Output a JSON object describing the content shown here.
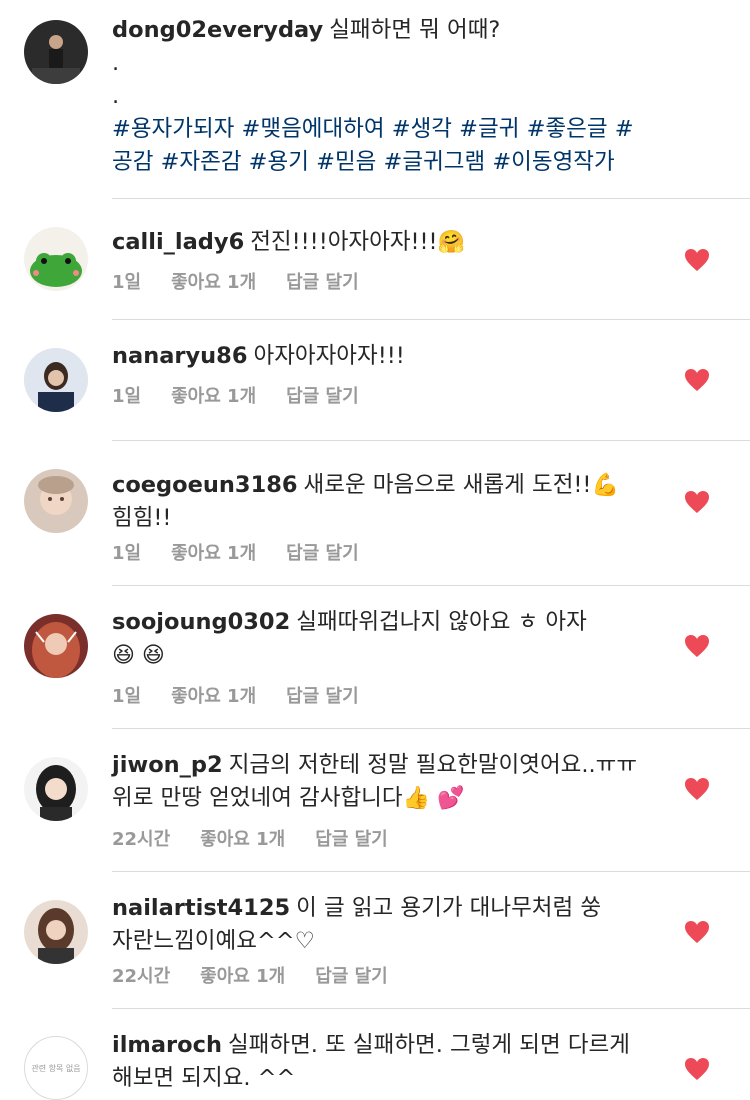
{
  "caption": {
    "username": "dong02everyday",
    "title": "실패하면 뭐 어때?",
    "dots": [
      ".",
      "."
    ],
    "hashtags": [
      "#용자가되자",
      "#맺음에대하여",
      "#생각",
      "#글귀",
      "#좋은글",
      "#공감",
      "#자존감",
      "#용기",
      "#믿음",
      "#글귀그램",
      "#이동영작가"
    ]
  },
  "comments": [
    {
      "username": "calli_lady6",
      "text": "전진!!!!아자아자!!!",
      "emoji": "🤗",
      "time": "1일",
      "likes": "좋아요 1개",
      "reply": "답글 달기"
    },
    {
      "username": "nanaryu86",
      "text": "아자아자아자!!!",
      "emoji": "",
      "time": "1일",
      "likes": "좋아요 1개",
      "reply": "답글 달기"
    },
    {
      "username": "coegoeun3186",
      "text": "새로운 마음으로 새롭게 도전!!",
      "emoji": "💪",
      "text2": "힘힘!!",
      "time": "1일",
      "likes": "좋아요 1개",
      "reply": "답글 달기"
    },
    {
      "username": "soojoung0302",
      "text": "실패따위겁나지 않아요 ㅎ 아자",
      "emoji": "😆 😆",
      "time": "1일",
      "likes": "좋아요 1개",
      "reply": "답글 달기"
    },
    {
      "username": "jiwon_p2",
      "text": "지금의 저한테 정말 필요한말이엿어요..ㅠㅠ 위로 만땅 얻었네여 감사합니다",
      "emoji": "👍 💕",
      "time": "22시간",
      "likes": "좋아요 1개",
      "reply": "답글 달기"
    },
    {
      "username": "nailartist4125",
      "text": "이 글 읽고 용기가 대나무처럼 쑹 자란느낌이예요^^♡",
      "emoji": "",
      "time": "22시간",
      "likes": "좋아요 1개",
      "reply": "답글 달기"
    },
    {
      "username": "ilmaroch",
      "text": "실패하면. 또 실패하면. 그렇게 되면 다르게 해보면 되지요. ^^",
      "emoji": "",
      "time": "",
      "likes": "",
      "reply": ""
    }
  ],
  "avatar_placeholder": "관련 항목 없음",
  "colors": {
    "heart": "#ed4956",
    "hashtag": "#003569",
    "meta": "#999999"
  }
}
